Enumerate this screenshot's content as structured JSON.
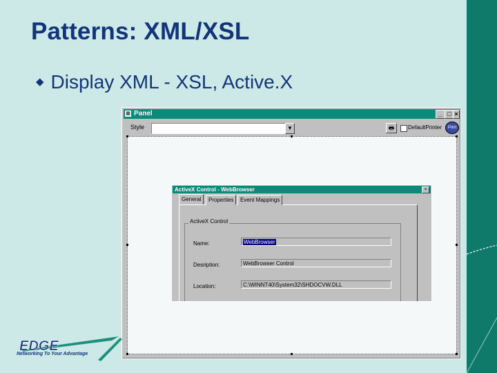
{
  "slide": {
    "title": "Patterns: XML/XSL",
    "bullet": "Display XML - XSL, Active.X",
    "logo_text": "EDGE",
    "logo_tagline": "Networking To Your Advantage",
    "colors": {
      "background": "#cce9e8",
      "band": "#0f7a69",
      "title": "#12357a"
    }
  },
  "panel_window": {
    "title": "Panel",
    "style_label": "Style",
    "style_value": "",
    "print_checkbox_label": "DefaultPrinter",
    "print_button_label": "Print"
  },
  "activex_dialog": {
    "title": "ActiveX Control - WebBrowser",
    "tabs": [
      "General",
      "Properties",
      "Event Mappings"
    ],
    "active_tab": "General",
    "group_label": "ActiveX Control",
    "fields": [
      {
        "label": "Name:",
        "value": "WebBrowser"
      },
      {
        "label": "Desription:",
        "value": "WebBrowser Control"
      },
      {
        "label": "Location:",
        "value": "C:\\WINNT40\\System32\\SHDOCVW.DLL"
      }
    ]
  }
}
